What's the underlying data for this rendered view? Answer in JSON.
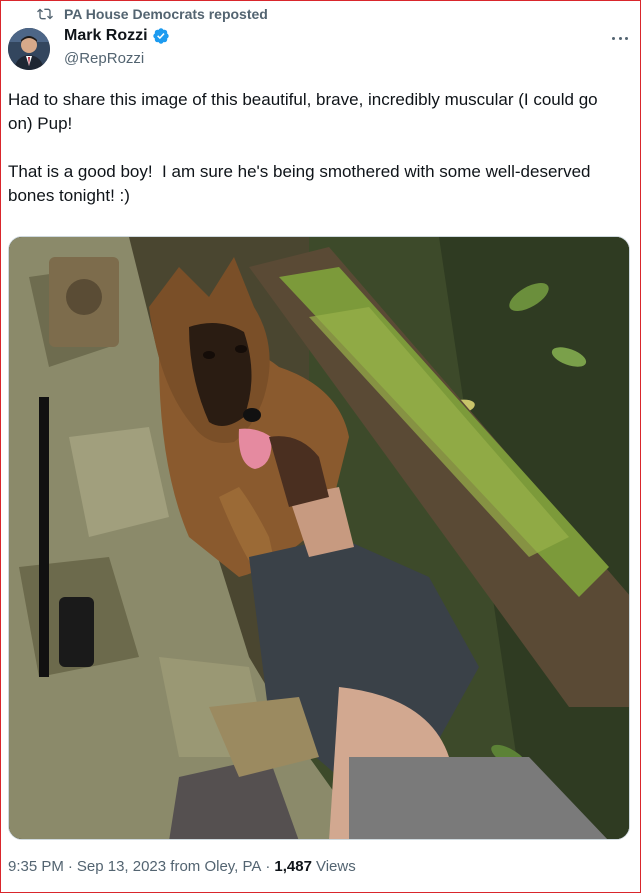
{
  "repost": {
    "label": "PA House Democrats reposted"
  },
  "author": {
    "name": "Mark Rozzi",
    "handle": "@RepRozzi"
  },
  "tweet": {
    "paragraphs": [
      "Had to share this image of this beautiful, brave, incredibly muscular (I could go on) Pup!",
      "That is a good boy!  I am sure he's being smothered with some well-deserved bones tonight! :)"
    ]
  },
  "meta": {
    "time": "9:35 PM",
    "separator": "·",
    "date": "Sep 13, 2023 from Oley, PA",
    "views_count": "1,487",
    "views_label": "Views"
  },
  "colors": {
    "accent": "#1d9bf0",
    "muted": "#536471",
    "text": "#0f1419"
  },
  "icons": {
    "repost": "repost-icon",
    "verified": "verified-badge-icon",
    "more": "more-icon"
  }
}
